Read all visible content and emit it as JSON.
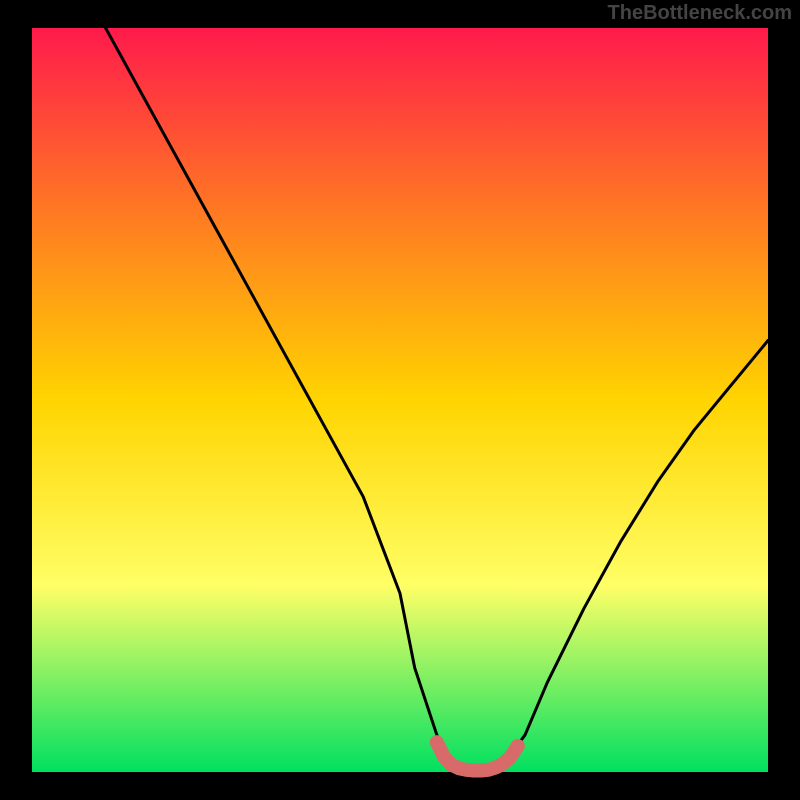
{
  "watermark": "TheBottleneck.com",
  "colors": {
    "background": "#000000",
    "gradient_top": "#ff1a4c",
    "gradient_mid1": "#ff7a22",
    "gradient_mid2": "#ffd400",
    "gradient_mid3": "#ffff66",
    "gradient_bottom": "#00e060",
    "curve": "#000000",
    "flat_segment": "#d86a6a",
    "watermark": "#444444"
  },
  "chart_data": {
    "type": "line",
    "title": "",
    "xlabel": "",
    "ylabel": "",
    "xlim": [
      0,
      100
    ],
    "ylim": [
      0,
      100
    ],
    "series": [
      {
        "name": "bottleneck-curve",
        "x": [
          10,
          15,
          20,
          25,
          30,
          35,
          40,
          45,
          50,
          52,
          55,
          57,
          58,
          60,
          62,
          64,
          67,
          70,
          75,
          80,
          85,
          90,
          95,
          100
        ],
        "y": [
          100,
          91,
          82,
          73,
          64,
          55,
          46,
          37,
          24,
          14,
          5,
          1,
          0,
          0,
          0,
          1,
          5,
          12,
          22,
          31,
          39,
          46,
          52,
          58
        ]
      },
      {
        "name": "flat-bottom-segment",
        "x": [
          55,
          56,
          57,
          58,
          59,
          60,
          61,
          62,
          63,
          64,
          65,
          66
        ],
        "y": [
          4,
          2,
          1,
          0.5,
          0.3,
          0.2,
          0.2,
          0.3,
          0.6,
          1.1,
          2,
          3.5
        ]
      }
    ],
    "flat_bottom_range_x": [
      55,
      66
    ],
    "notes": "Background is a smooth vertical gradient from red/pink through orange and yellow to green at the bottom, framed by black. A V-shaped black curve dips to zero around x≈60; the trough is overdrawn with a thick pink segment."
  }
}
